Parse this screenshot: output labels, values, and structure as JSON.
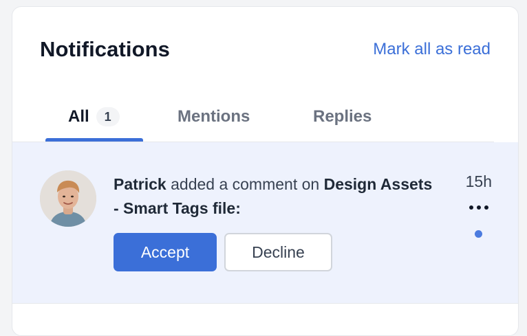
{
  "header": {
    "title": "Notifications",
    "mark_all_label": "Mark all as read"
  },
  "tabs": [
    {
      "label": "All",
      "count": "1",
      "active": true
    },
    {
      "label": "Mentions",
      "active": false
    },
    {
      "label": "Replies",
      "active": false
    }
  ],
  "notification": {
    "actor": "Patrick",
    "action": " added a comment on ",
    "target": "Design Assets - Smart Tags file:",
    "time": "15h",
    "unread": true,
    "accept_label": "Accept",
    "decline_label": "Decline"
  },
  "colors": {
    "accent": "#3b6fd8",
    "unread_bg": "#eef2fd"
  },
  "icons": {
    "more": "more-horizontal-icon",
    "unread": "unread-dot-icon"
  }
}
